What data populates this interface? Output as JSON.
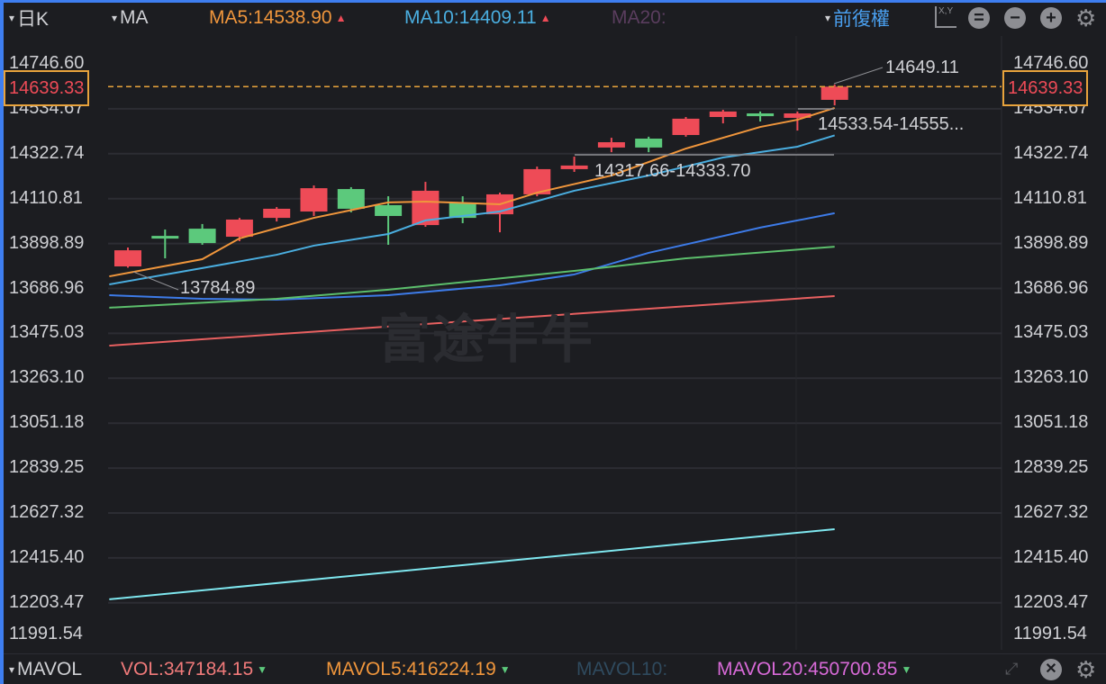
{
  "toolbar": {
    "period": "日K",
    "indicator": "MA",
    "ma5": "MA5:14538.90",
    "ma10": "MA10:14409.11",
    "ma20": "MA20:",
    "adjust": "前復權",
    "xy_label": "X,Y",
    "up_arrow": "▲",
    "caret": "▾"
  },
  "volume_bar": {
    "indicator": "MAVOL",
    "vol": "VOL:347184.15",
    "mavol5": "MAVOL5:416224.19",
    "mavol10": "MAVOL10:",
    "mavol20": "MAVOL20:450700.85",
    "down_arrow": "▼",
    "caret": "▾"
  },
  "watermark": "富途牛牛",
  "colors": {
    "up": "#ee4b57",
    "down": "#5cc97c",
    "ma5": "#f0963c",
    "ma10": "#4aaee0",
    "ma20": "#3d7be8",
    "ma30": "#5cbf6c",
    "ma60": "#e86060",
    "ma120": "#7fe8f0",
    "current": "#e8a33c"
  },
  "chart_data": {
    "type": "candlestick",
    "y_ticks": [
      "14746.60",
      "14534.67",
      "14322.74",
      "14110.81",
      "13898.89",
      "13686.96",
      "13475.03",
      "13263.10",
      "13051.18",
      "12839.25",
      "12627.32",
      "12415.40",
      "12203.47",
      "11991.54"
    ],
    "ylim": [
      11991.54,
      14746.6
    ],
    "current_price": "14639.33",
    "candles": [
      [
        13791,
        13880,
        13784.89,
        13867
      ],
      [
        13935,
        13965,
        13829,
        13923
      ],
      [
        13969,
        13991,
        13893,
        13901
      ],
      [
        13931,
        14020,
        13910,
        14012
      ],
      [
        14020,
        14071,
        14003,
        14063
      ],
      [
        14050,
        14173,
        14029,
        14160
      ],
      [
        14156,
        14165,
        14046,
        14063
      ],
      [
        14080,
        14122,
        13893,
        14029
      ],
      [
        13986,
        14190,
        13978,
        14148
      ],
      [
        14092,
        14122,
        13995,
        14020
      ],
      [
        14037,
        14139,
        13952,
        14131
      ],
      [
        14131,
        14262,
        14122,
        14250
      ],
      [
        14250,
        14309,
        14237,
        14267
      ],
      [
        14352,
        14398,
        14330,
        14377
      ],
      [
        14394,
        14403,
        14330,
        14352
      ],
      [
        14411,
        14496,
        14403,
        14488
      ],
      [
        14496,
        14530,
        14466,
        14522
      ],
      [
        14513,
        14522,
        14475,
        14500
      ],
      [
        14492,
        14522,
        14432,
        14513
      ],
      [
        14577,
        14649.11,
        14551,
        14639.33
      ]
    ],
    "lines": [
      {
        "name": "MA5",
        "color": "#f0963c",
        "points": [
          [
            -0.5,
            13744
          ],
          [
            2,
            13825
          ],
          [
            3,
            13923
          ],
          [
            5,
            14020
          ],
          [
            7,
            14093
          ],
          [
            8,
            14097
          ],
          [
            10,
            14084
          ],
          [
            11,
            14139
          ],
          [
            13,
            14220
          ],
          [
            15,
            14347
          ],
          [
            17,
            14449
          ],
          [
            18,
            14483
          ],
          [
            19,
            14538.9
          ]
        ]
      },
      {
        "name": "MA10",
        "color": "#4aaee0",
        "points": [
          [
            -0.5,
            13706
          ],
          [
            2,
            13783
          ],
          [
            4,
            13846
          ],
          [
            5,
            13889
          ],
          [
            7,
            13944
          ],
          [
            8,
            14008
          ],
          [
            10,
            14050
          ],
          [
            12,
            14148
          ],
          [
            14,
            14220
          ],
          [
            16,
            14305
          ],
          [
            18,
            14356
          ],
          [
            19,
            14409.11
          ]
        ]
      },
      {
        "name": "MA20",
        "color": "#3d7be8",
        "points": [
          [
            -0.5,
            13655
          ],
          [
            2,
            13638
          ],
          [
            4,
            13634
          ],
          [
            7,
            13655
          ],
          [
            10,
            13702
          ],
          [
            12,
            13753
          ],
          [
            14,
            13855
          ],
          [
            17,
            13974
          ],
          [
            19,
            14042
          ]
        ]
      },
      {
        "name": "MA30",
        "color": "#5cbf6c",
        "points": [
          [
            -0.5,
            13596
          ],
          [
            4,
            13638
          ],
          [
            7,
            13681
          ],
          [
            12,
            13770
          ],
          [
            15,
            13829
          ],
          [
            19,
            13884
          ]
        ]
      },
      {
        "name": "MA60",
        "color": "#e86060",
        "points": [
          [
            -0.5,
            13417
          ],
          [
            19,
            13651
          ]
        ]
      },
      {
        "name": "MA120",
        "color": "#7fe8f0",
        "points": [
          [
            -0.5,
            12220
          ],
          [
            19,
            12551
          ]
        ]
      }
    ],
    "annotations": {
      "high": "14649.11",
      "low": "13784.89",
      "range1": "14317.66-14333.70",
      "range2": "14533.54-14555..."
    }
  }
}
